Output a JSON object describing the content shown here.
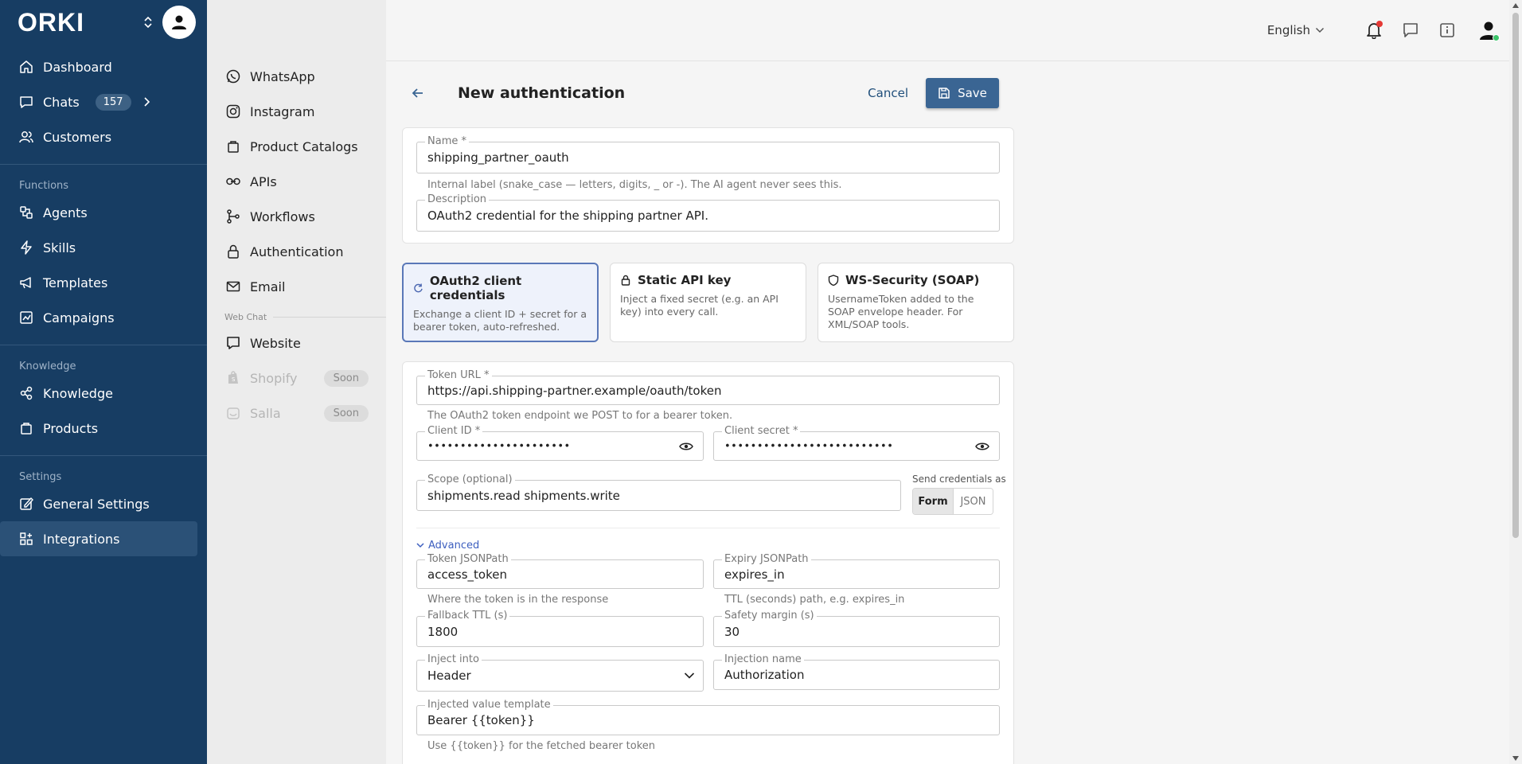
{
  "brand": {
    "logo_text": "ORKI"
  },
  "sidebar": {
    "items": [
      {
        "label": "Dashboard"
      },
      {
        "label": "Chats",
        "badge": "157"
      },
      {
        "label": "Customers"
      }
    ],
    "functions_label": "Functions",
    "functions": [
      {
        "label": "Agents"
      },
      {
        "label": "Skills"
      },
      {
        "label": "Templates"
      },
      {
        "label": "Campaigns"
      }
    ],
    "knowledge_label": "Knowledge",
    "knowledge": [
      {
        "label": "Knowledge"
      },
      {
        "label": "Products"
      }
    ],
    "settings_label": "Settings",
    "settings": [
      {
        "label": "General Settings"
      },
      {
        "label": "Integrations"
      }
    ]
  },
  "subnav": {
    "items": [
      {
        "label": "WhatsApp"
      },
      {
        "label": "Instagram"
      },
      {
        "label": "Product Catalogs"
      },
      {
        "label": "APIs"
      },
      {
        "label": "Workflows"
      },
      {
        "label": "Authentication"
      },
      {
        "label": "Email"
      }
    ],
    "webchat_label": "Web Chat",
    "webchat": [
      {
        "label": "Website"
      },
      {
        "label": "Shopify",
        "soon": "Soon"
      },
      {
        "label": "Salla",
        "soon": "Soon"
      }
    ]
  },
  "topbar": {
    "language": "English"
  },
  "page": {
    "title": "New authentication",
    "cancel_label": "Cancel",
    "save_label": "Save"
  },
  "basic": {
    "name_label": "Name *",
    "name_value": "shipping_partner_oauth",
    "name_help": "Internal label (snake_case — letters, digits, _ or -). The AI agent never sees this.",
    "desc_label": "Description",
    "desc_value": "OAuth2 credential for the shipping partner API."
  },
  "auth_types": [
    {
      "title": "OAuth2 client credentials",
      "desc": "Exchange a client ID + secret for a bearer token, auto-refreshed."
    },
    {
      "title": "Static API key",
      "desc": "Inject a fixed secret (e.g. an API key) into every call."
    },
    {
      "title": "WS-Security (SOAP)",
      "desc": "UsernameToken added to the SOAP envelope header. For XML/SOAP tools."
    }
  ],
  "oauth": {
    "token_url_label": "Token URL *",
    "token_url_value": "https://api.shipping-partner.example/oauth/token",
    "token_url_help": "The OAuth2 token endpoint we POST to for a bearer token.",
    "client_id_label": "Client ID *",
    "client_id_value": "••••••••••••••••••••••",
    "client_secret_label": "Client secret *",
    "client_secret_value": "••••••••••••••••••••••••••",
    "scope_label": "Scope (optional)",
    "scope_value": "shipments.read shipments.write",
    "send_as_label": "Send credentials as",
    "send_as_form": "Form",
    "send_as_json": "JSON",
    "advanced_label": "Advanced",
    "token_jsonpath_label": "Token JSONPath",
    "token_jsonpath_value": "access_token",
    "token_jsonpath_help": "Where the token is in the response",
    "expiry_jsonpath_label": "Expiry JSONPath",
    "expiry_jsonpath_value": "expires_in",
    "expiry_jsonpath_help": "TTL (seconds) path, e.g. expires_in",
    "fallback_ttl_label": "Fallback TTL (s)",
    "fallback_ttl_value": "1800",
    "safety_margin_label": "Safety margin (s)",
    "safety_margin_value": "30",
    "inject_into_label": "Inject into",
    "inject_into_value": "Header",
    "injection_name_label": "Injection name",
    "injection_name_value": "Authorization",
    "template_label": "Injected value template",
    "template_value": "Bearer {{token}}",
    "template_help": "Use {{token}} for the fetched bearer token"
  },
  "colors": {
    "sidebar_bg": "#173d63",
    "accent": "#3a6593",
    "selected_border": "#5a78b8",
    "link": "#3d5fbf"
  }
}
